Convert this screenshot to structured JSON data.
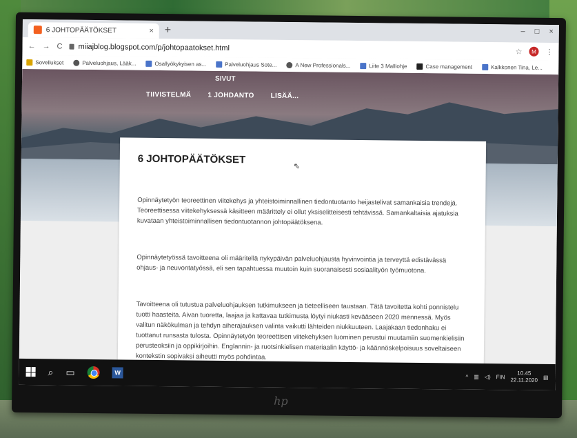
{
  "browser": {
    "tab_title": "6 JOHTOPÄÄTÖKSET",
    "tab_close": "×",
    "new_tab": "+",
    "url": "miiajblog.blogspot.com/p/johtopaatokset.html",
    "win_controls": [
      "–",
      "□",
      "×"
    ],
    "bookmarks": [
      {
        "label": "Sovellukset",
        "icon": "apps-icon"
      },
      {
        "label": "Palveluohjaus, Lääk...",
        "icon": "globe-icon"
      },
      {
        "label": "Osallyökykyisen as...",
        "icon": "doc-icon"
      },
      {
        "label": "Palveluohjaus Sote...",
        "icon": "doc-icon"
      },
      {
        "label": "A New Professionals...",
        "icon": "globe-icon"
      },
      {
        "label": "Liite 3 Malliohje",
        "icon": "doc-icon"
      },
      {
        "label": "Case management",
        "icon": "k-icon"
      },
      {
        "label": "Kalkkonen Tina, Le...",
        "icon": "doc-icon"
      }
    ],
    "profile_initial": "M"
  },
  "blog": {
    "nav_top": "SIVUT",
    "nav": [
      "TIIVISTELMÄ",
      "1 JOHDANTO",
      "LISÄÄ..."
    ],
    "title": "6 JOHTOPÄÄTÖKSET",
    "paragraphs": [
      "Opinnäytetyön teoreettinen viitekehys ja yhteistoiminnallinen tiedontuotanto heijastelivat samankaisia trendejä. Teoreettisessa viitekehyksessä käsitteen määrittely ei ollut yksiselitteisesti tehtävissä. Samankaltaisia ajatuksia kuvataan yhteistoiminnallisen tiedontuotannon johtopäätöksena.",
      "Opinnäytetyössä tavoitteena oli määritellä nykypäivän palveluohjausta hyvinvointia ja terveyttä edistävässä ohjaus- ja neuvontatyössä, eli sen tapahtuessa muutoin kuin suoranaisesti sosiaalityön työmuotona.",
      "Tavoitteena oli tutustua palveluohjauksen tutkimukseen ja tieteelliseen taustaan. Tätä tavoitetta kohti ponnistelu tuotti haasteita. Aivan tuoretta, laajaa ja kattavaa tutkimusta löytyi niukasti kevääseen 2020 mennessä. Myös valitun näkökulman ja tehdyn aiherajauksen valinta vaikutti lähteiden niukkuuteen. Laajakaan tiedonhaku ei tuottanut runsasta tulosta. Opinnäytetyön teoreettisen viitekehyksen luominen perustui muutamiin suomenkielisiin perusteoksiin ja oppikirjoihin. Englannin- ja ruotsinkielisen materiaalin käyttö- ja käännöskelpoisuus soveltaiseen kontekstin sopivaksi aiheutti myös pohdintaa."
    ]
  },
  "taskbar": {
    "lang": "FIN",
    "time": "10.45",
    "date": "22.11.2020"
  },
  "monitor": {
    "brand": "hp"
  }
}
